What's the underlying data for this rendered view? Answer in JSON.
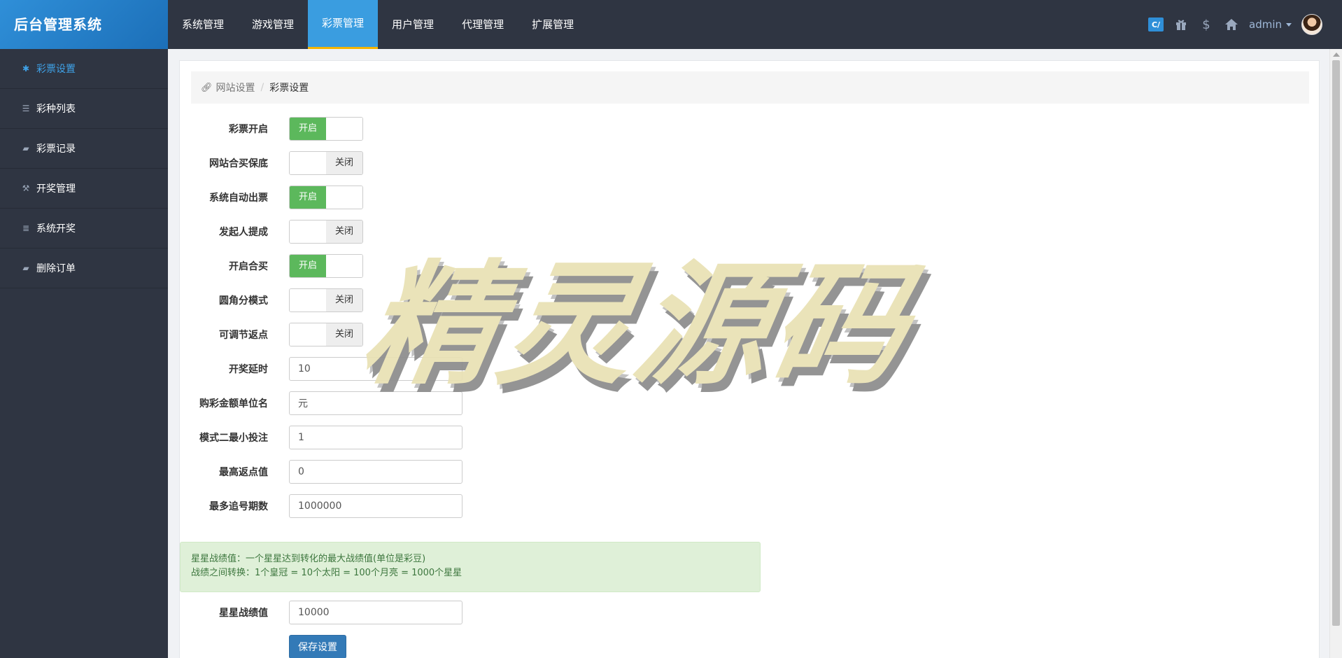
{
  "brand": "后台管理系统",
  "top_nav": [
    {
      "label": "系统管理",
      "active": false
    },
    {
      "label": "游戏管理",
      "active": false
    },
    {
      "label": "彩票管理",
      "active": true
    },
    {
      "label": "用户管理",
      "active": false
    },
    {
      "label": "代理管理",
      "active": false
    },
    {
      "label": "扩展管理",
      "active": false
    }
  ],
  "top_right": {
    "app_icon": "app-icon",
    "gift_icon": "gift-icon",
    "dollar_icon": "dollar-icon",
    "home_icon": "home-icon",
    "user": "admin"
  },
  "sidebar": [
    {
      "label": "彩票设置",
      "icon": "asterisk-icon",
      "active": true
    },
    {
      "label": "彩种列表",
      "icon": "list-icon",
      "active": false
    },
    {
      "label": "彩票记录",
      "icon": "book-icon",
      "active": false
    },
    {
      "label": "开奖管理",
      "icon": "gavel-icon",
      "active": false
    },
    {
      "label": "系统开奖",
      "icon": "server-icon",
      "active": false
    },
    {
      "label": "删除订单",
      "icon": "book-icon",
      "active": false
    }
  ],
  "breadcrumb": {
    "parent": "网站设置",
    "sep": "/",
    "current": "彩票设置"
  },
  "toggle_text": {
    "on": "开启",
    "off": "关闭"
  },
  "form": {
    "toggles": [
      {
        "label": "彩票开启",
        "state": "on"
      },
      {
        "label": "网站合买保底",
        "state": "off"
      },
      {
        "label": "系统自动出票",
        "state": "on"
      },
      {
        "label": "发起人提成",
        "state": "off"
      },
      {
        "label": "开启合买",
        "state": "on"
      },
      {
        "label": "圆角分模式",
        "state": "off"
      },
      {
        "label": "可调节返点",
        "state": "off"
      }
    ],
    "inputs": [
      {
        "label": "开奖延时",
        "value": "10"
      },
      {
        "label": "购彩金额单位名",
        "value": "元"
      },
      {
        "label": "模式二最小投注",
        "value": "1"
      },
      {
        "label": "最高返点值",
        "value": "0"
      },
      {
        "label": "最多追号期数",
        "value": "1000000"
      }
    ],
    "alert": {
      "line1": "星星战绩值：一个星星达到转化的最大战绩值(单位是彩豆)",
      "line2": "战绩之间转换：1个皇冠 = 10个太阳 = 100个月亮 = 1000个星星"
    },
    "star_value": {
      "label": "星星战绩值",
      "value": "10000"
    },
    "save_label": "保存设置"
  },
  "watermark": "精灵源码"
}
